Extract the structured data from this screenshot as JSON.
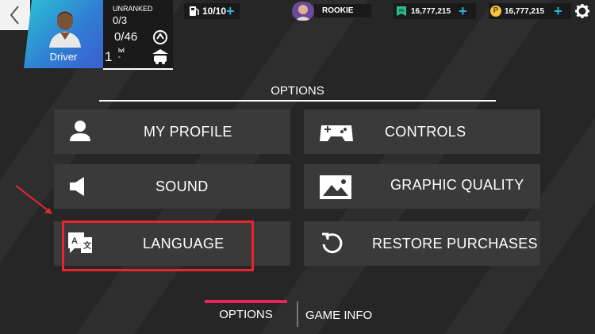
{
  "profile": {
    "name": "Driver",
    "rank_label": "UNRANKED",
    "rank_progress": "0/3",
    "xp_progress": "0/46",
    "level": "1",
    "level_unit": "lvl"
  },
  "resources": {
    "fuel": "10/10",
    "club_name": "ROOKIE",
    "gems": "16,777,215",
    "coins": "16,777,215",
    "coin_symbol": "P"
  },
  "options": {
    "title": "OPTIONS",
    "items": [
      {
        "label": "MY PROFILE",
        "icon": "user-icon"
      },
      {
        "label": "CONTROLS",
        "icon": "gamepad-icon"
      },
      {
        "label": "SOUND",
        "icon": "speaker-icon"
      },
      {
        "label": "GRAPHIC QUALITY",
        "icon": "image-icon"
      },
      {
        "label": "LANGUAGE",
        "icon": "translate-icon"
      },
      {
        "label": "RESTORE PURCHASES",
        "icon": "restore-icon"
      }
    ]
  },
  "tabs": [
    {
      "label": "OPTIONS",
      "active": true
    },
    {
      "label": "GAME INFO",
      "active": false
    }
  ],
  "colors": {
    "accent_tab": "#e8235f",
    "highlight": "#e8262d",
    "plus": "#29b6d8",
    "tile_bg": "#3a3a3a"
  }
}
